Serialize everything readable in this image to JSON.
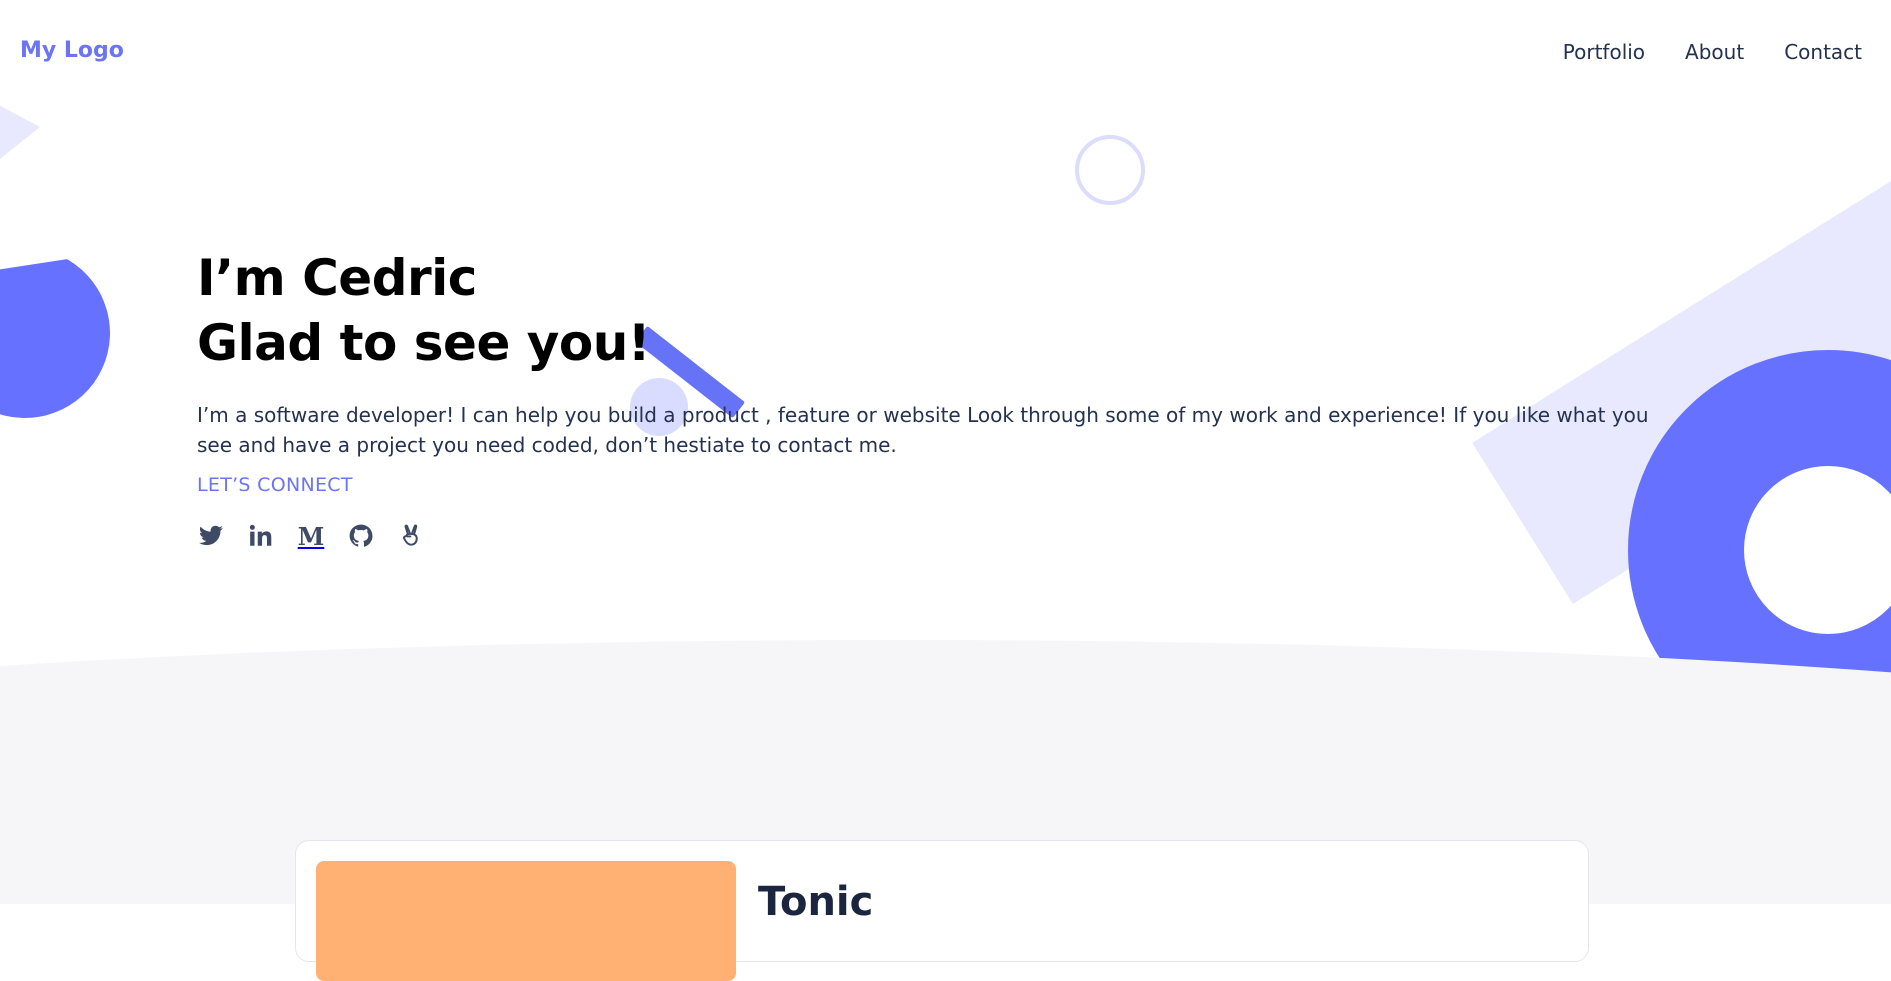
{
  "header": {
    "logo": "My Logo",
    "nav": [
      "Portfolio",
      "About",
      "Contact"
    ]
  },
  "hero": {
    "headline_line1": "I’m Cedric",
    "headline_line2": "Glad to see you!",
    "intro": "I’m a software developer! I can help you build a product , feature or website Look through some of my work and experience! If you like what you see and have a project you need coded, don’t hestiate to contact me.",
    "cta": "LET’S CONNECT",
    "social_icons": [
      "twitter-icon",
      "linkedin-icon",
      "medium-icon",
      "github-icon",
      "angellist-icon"
    ]
  },
  "projects": {
    "first_card_title": "Tonic"
  },
  "colors": {
    "accent": "#6b74f5",
    "shape_blue": "#6672ff",
    "shape_light": "#e8e9ff",
    "card_thumb": "#ffb072",
    "lower_bg": "#f6f6f8"
  }
}
